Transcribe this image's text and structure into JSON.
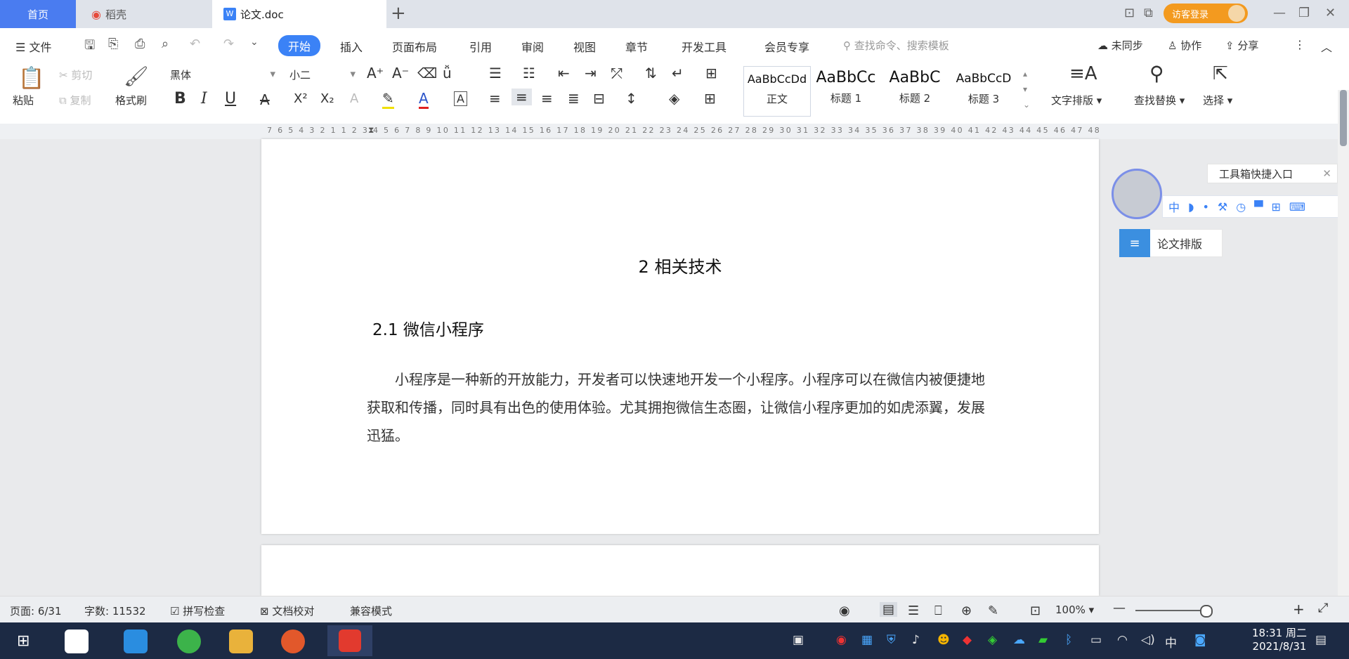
{
  "tabs": {
    "home": "首页",
    "daoke": "稻壳",
    "doc": "论文.doc",
    "new_tab": "+"
  },
  "header": {
    "login_label": "访客登录"
  },
  "menu": {
    "file": "文件",
    "items": [
      "开始",
      "插入",
      "页面布局",
      "引用",
      "审阅",
      "视图",
      "章节",
      "开发工具",
      "会员专享"
    ],
    "search_placeholder": "查找命令、搜索模板",
    "sync": "未同步",
    "collab": "协作",
    "share": "分享"
  },
  "ribbon": {
    "paste": "粘贴",
    "cut": "剪切",
    "copy": "复制",
    "format_painter": "格式刷",
    "font_name": "黑体",
    "font_size": "小二",
    "bold": "B",
    "italic": "I",
    "underline": "U",
    "styles": [
      {
        "sample": "AaBbCcDd",
        "label": "正文"
      },
      {
        "sample": "AaBbCc",
        "label": "标题 1"
      },
      {
        "sample": "AaBbC",
        "label": "标题 2"
      },
      {
        "sample": "AaBbCcD",
        "label": "标题 3"
      }
    ],
    "text_layout": "文字排版",
    "find_replace": "查找替换",
    "select": "选择"
  },
  "ruler": {
    "numbers": "7 6 5 4 3 2 1 1 2 3 4 5 6 7 8 9 10 11 12 13 14 15 16 17 18 19 20 21 22 23 24 25 26 27 28 29 30 31 32 33 34 35 36 37 38 39 40 41 42 43 44 45 46 47 48"
  },
  "document": {
    "chapter_title": "2 相关技术",
    "section_title": "2.1 微信小程序",
    "paragraph": "小程序是一种新的开放能力，开发者可以快速地开发一个小程序。小程序可以在微信内被便捷地获取和传播，同时具有出色的使用体验。尤其拥抱微信生态圈，让微信小程序更加的如虎添翼，发展迅猛。"
  },
  "side_panel": {
    "toolbox_tip": "工具箱快捷入口",
    "float_bar_text": "中",
    "lunwen_layout": "论文排版"
  },
  "status": {
    "page": "页面: 6/31",
    "words": "字数: 11532",
    "spell_check": "拼写检查",
    "doc_proof": "文档校对",
    "compat_mode": "兼容模式",
    "zoom": "100%"
  },
  "taskbar": {
    "time": "18:31 周二",
    "date": "2021/8/31",
    "ime": "中"
  },
  "colors": {
    "accent": "#3b82f6",
    "home_tab": "#4a7cf0",
    "login": "#f39a1f",
    "taskbar": "#1c2a44"
  }
}
